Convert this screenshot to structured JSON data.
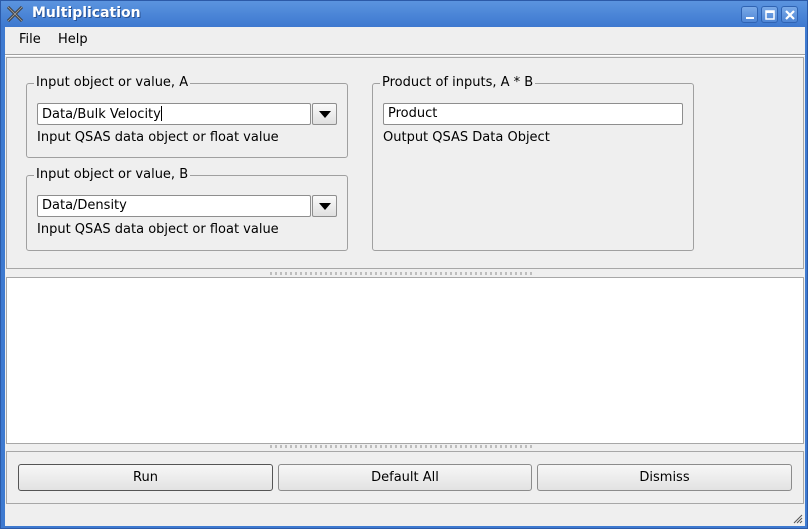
{
  "window": {
    "title": "Multiplication",
    "controls": {
      "minimize": "minimize-icon",
      "maximize": "maximize-icon",
      "close": "close-icon"
    }
  },
  "menubar": {
    "items": [
      {
        "label": "File"
      },
      {
        "label": "Help"
      }
    ]
  },
  "inputs": {
    "a": {
      "legend": "Input object or value, A",
      "value": "Data/Bulk Velocity",
      "hint": "Input QSAS data object or float value"
    },
    "b": {
      "legend": "Input object or value, B",
      "value": "Data/Density",
      "hint": "Input QSAS data object or float value"
    }
  },
  "output": {
    "legend": "Product of inputs, A * B",
    "value": "Product",
    "hint": "Output QSAS Data Object"
  },
  "log": {
    "text": ""
  },
  "buttons": {
    "run": "Run",
    "default_all": "Default All",
    "dismiss": "Dismiss"
  }
}
